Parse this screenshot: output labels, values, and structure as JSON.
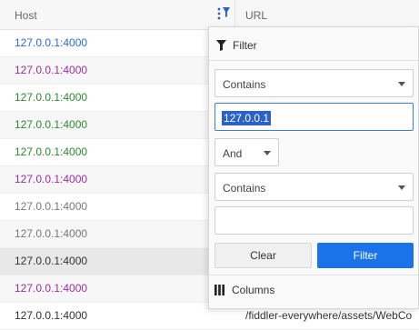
{
  "grid": {
    "columns": {
      "host": "Host",
      "url": "URL"
    },
    "rows": [
      {
        "host": "127.0.0.1:4000",
        "color": "#2f6bd8",
        "url": ""
      },
      {
        "host": "127.0.0.1:4000",
        "color": "#9b2ea8",
        "url": ""
      },
      {
        "host": "127.0.0.1:4000",
        "color": "#2e8a2e",
        "url": ""
      },
      {
        "host": "127.0.0.1:4000",
        "color": "#2e8a2e",
        "url": ""
      },
      {
        "host": "127.0.0.1:4000",
        "color": "#2e8a2e",
        "url": ""
      },
      {
        "host": "127.0.0.1:4000",
        "color": "#9b2ea8",
        "url": ""
      },
      {
        "host": "127.0.0.1:4000",
        "color": "#777777",
        "url": ""
      },
      {
        "host": "127.0.0.1:4000",
        "color": "#777777",
        "url": ""
      },
      {
        "host": "127.0.0.1:4000",
        "color": "#333333",
        "url": ""
      },
      {
        "host": "127.0.0.1:4000",
        "color": "#9b2ea8",
        "url": ""
      },
      {
        "host": "127.0.0.1:4000",
        "color": "#333333",
        "url": "/fiddler-everywhere/assets/WebCo"
      }
    ]
  },
  "filter_panel": {
    "title": "Filter",
    "condition1": "Contains",
    "value1": "127.0.0.1",
    "logic": "And",
    "condition2": "Contains",
    "value2": "",
    "clear_label": "Clear",
    "filter_label": "Filter",
    "columns_label": "Columns"
  },
  "colors": {
    "accent": "#1a73e8",
    "selection": "#2b62c8"
  }
}
